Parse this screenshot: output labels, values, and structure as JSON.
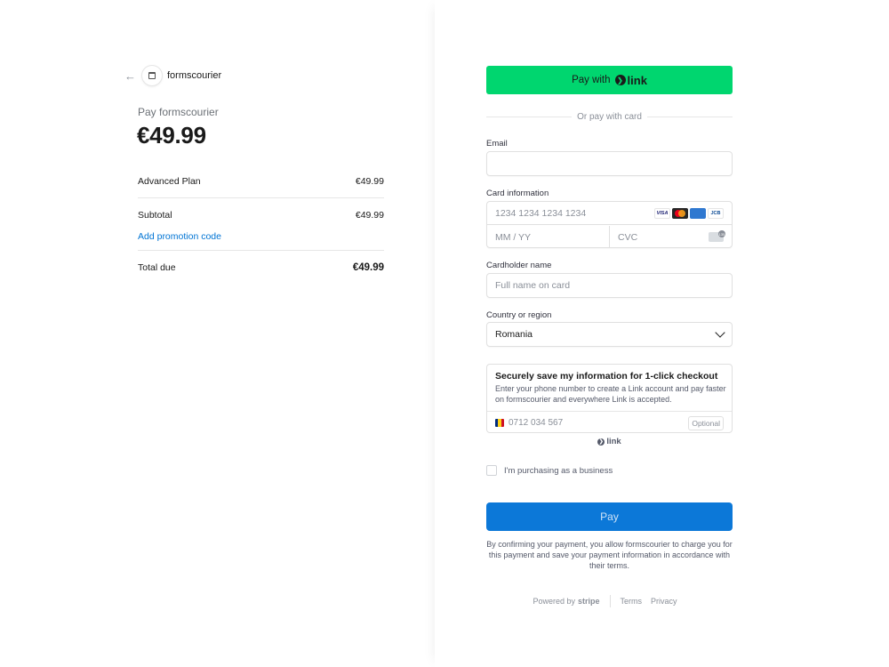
{
  "merchant": {
    "name": "formscourier",
    "back_icon": "arrow-left-icon"
  },
  "summary": {
    "pay_label": "Pay formscourier",
    "amount": "€49.99",
    "items": [
      {
        "name": "Advanced Plan",
        "price": "€49.99"
      }
    ],
    "subtotal_label": "Subtotal",
    "subtotal_value": "€49.99",
    "promo_label": "Add promotion code",
    "total_label": "Total due",
    "total_value": "€49.99"
  },
  "payment": {
    "link_button_label": "Pay with",
    "link_brand": "link",
    "divider_text": "Or pay with card",
    "email_label": "Email",
    "email_value": "",
    "card_label": "Card information",
    "card_number_placeholder": "1234 1234 1234 1234",
    "card_brands": [
      "VISA",
      "Mastercard",
      "AMEX",
      "JCB"
    ],
    "expiry_placeholder": "MM / YY",
    "cvc_placeholder": "CVC",
    "cvc_icon_text": "135",
    "cardholder_label": "Cardholder name",
    "cardholder_placeholder": "Full name on card",
    "country_label": "Country or region",
    "country_value": "Romania",
    "save_title": "Securely save my information for 1-click checkout",
    "save_description": "Enter your phone number to create a Link account and pay faster on formscourier and everywhere Link is accepted.",
    "phone_placeholder": "0712 034 567",
    "optional_label": "Optional",
    "link_footer_label": "link",
    "business_label": "I'm purchasing as a business",
    "pay_button_label": "Pay",
    "consent_text": "By confirming your payment, you allow formscourier to charge you for this payment and save your payment information in accordance with their terms."
  },
  "footer": {
    "powered_by": "Powered by",
    "brand": "stripe",
    "terms": "Terms",
    "privacy": "Privacy"
  },
  "colors": {
    "link_green": "#00d66f",
    "pay_blue": "#0c78d8",
    "promo_blue": "#0074d4",
    "flag": [
      "#002b7f",
      "#fcd116",
      "#ce1126"
    ]
  }
}
